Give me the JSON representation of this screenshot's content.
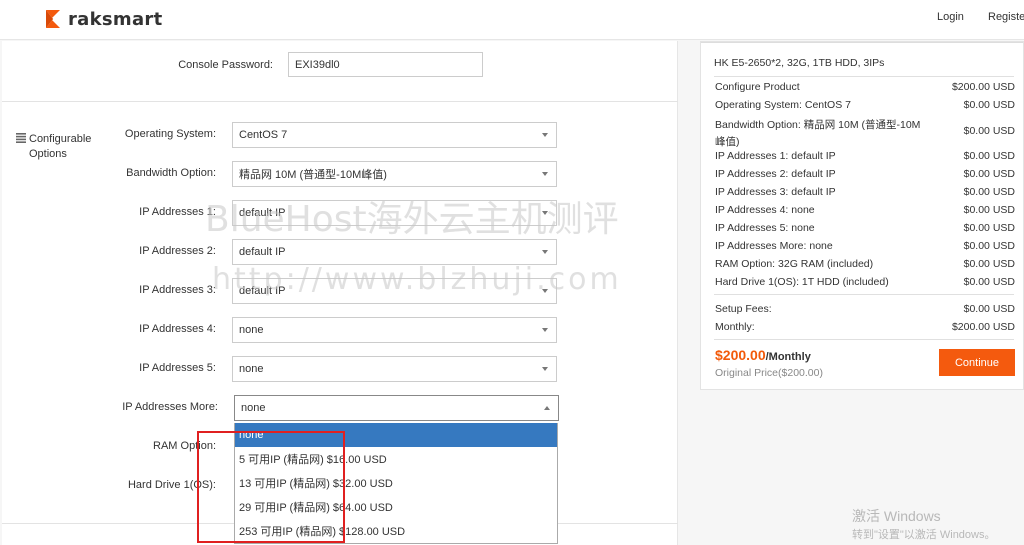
{
  "header": {
    "logo_text": "raksmart",
    "login": "Login",
    "register": "Registe"
  },
  "console": {
    "label": "Console Password:",
    "value": "EXI39dl0"
  },
  "section": {
    "icon": "list-icon",
    "title_line1": "Configurable",
    "title_line2": "Options"
  },
  "options": [
    {
      "label": "Operating System:",
      "value": "CentOS 7"
    },
    {
      "label": "Bandwidth Option:",
      "value": "精品网 10M (普通型-10M峰值)"
    },
    {
      "label": "IP Addresses 1:",
      "value": "default IP"
    },
    {
      "label": "IP Addresses 2:",
      "value": "default IP"
    },
    {
      "label": "IP Addresses 3:",
      "value": "default IP"
    },
    {
      "label": "IP Addresses 4:",
      "value": "none"
    },
    {
      "label": "IP Addresses 5:",
      "value": "none"
    },
    {
      "label": "IP Addresses More:",
      "value": "none"
    }
  ],
  "partial_labels": {
    "ram": "RAM Option:",
    "hdd": "Hard Drive 1(OS):"
  },
  "dropdown": {
    "items": [
      "none",
      "5 可用IP (精品网) $16.00 USD",
      "13 可用IP (精品网) $32.00 USD",
      "29 可用IP (精品网) $64.00 USD",
      "253 可用IP (精品网) $128.00 USD"
    ],
    "selected_index": 0
  },
  "summary": {
    "title": "HK E5-2650*2, 32G, 1TB HDD, 3IPs",
    "rows": [
      {
        "label": "Configure Product",
        "price": "$200.00 USD"
      },
      {
        "label": "Operating System: CentOS 7",
        "price": "$0.00 USD"
      },
      {
        "label": "Bandwidth Option: 精品网 10M (普通型-10M",
        "label2": "峰值)",
        "price": "$0.00 USD"
      },
      {
        "label": "IP Addresses 1: default IP",
        "price": "$0.00 USD"
      },
      {
        "label": "IP Addresses 2: default IP",
        "price": "$0.00 USD"
      },
      {
        "label": "IP Addresses 3: default IP",
        "price": "$0.00 USD"
      },
      {
        "label": "IP Addresses 4: none",
        "price": "$0.00 USD"
      },
      {
        "label": "IP Addresses 5: none",
        "price": "$0.00 USD"
      },
      {
        "label": "IP Addresses More: none",
        "price": "$0.00 USD"
      },
      {
        "label": "RAM Option: 32G RAM (included)",
        "price": "$0.00 USD"
      },
      {
        "label": "Hard Drive 1(OS): 1T HDD (included)",
        "price": "$0.00 USD"
      }
    ],
    "setup_fees": {
      "label": "Setup Fees:",
      "price": "$0.00 USD"
    },
    "monthly": {
      "label": "Monthly:",
      "price": "$200.00 USD"
    },
    "total": "$200.00",
    "total_period": "/Monthly",
    "original": "Original Price($200.00)",
    "continue": "Continue"
  },
  "watermark": {
    "line1": "BlueHost海外云主机测评",
    "line2": "http://www.blzhuji.com"
  },
  "windows": {
    "line1": "激活 Windows",
    "line2": "转到\"设置\"以激活 Windows。"
  },
  "colors": {
    "accent": "#f45a0e",
    "selected": "#3679c0",
    "highlight_box": "#e02020"
  }
}
